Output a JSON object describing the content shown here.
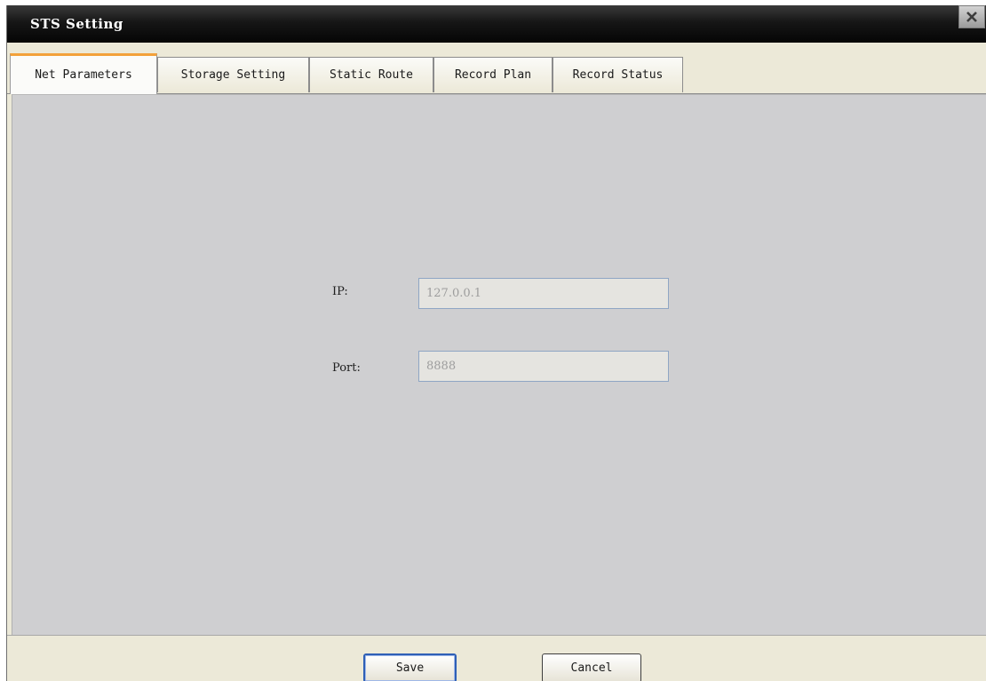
{
  "window": {
    "title": "STS Setting"
  },
  "titlebar": {
    "close_icon": "close-icon"
  },
  "tabs": [
    {
      "label": "Net Parameters",
      "active": true
    },
    {
      "label": "Storage Setting",
      "active": false
    },
    {
      "label": "Static Route",
      "active": false
    },
    {
      "label": "Record Plan",
      "active": false
    },
    {
      "label": "Record Status",
      "active": false
    }
  ],
  "form": {
    "ip_label": "IP:",
    "ip_value": "127.0.0.1",
    "port_label": "Port:",
    "port_value": "8888"
  },
  "footer": {
    "save_label": "Save",
    "cancel_label": "Cancel"
  },
  "colors": {
    "active_tab_accent": "#f3a13a",
    "panel_background": "#cfcfd1",
    "titlebar": "#111111",
    "default_button_border": "#2e5fb6"
  }
}
